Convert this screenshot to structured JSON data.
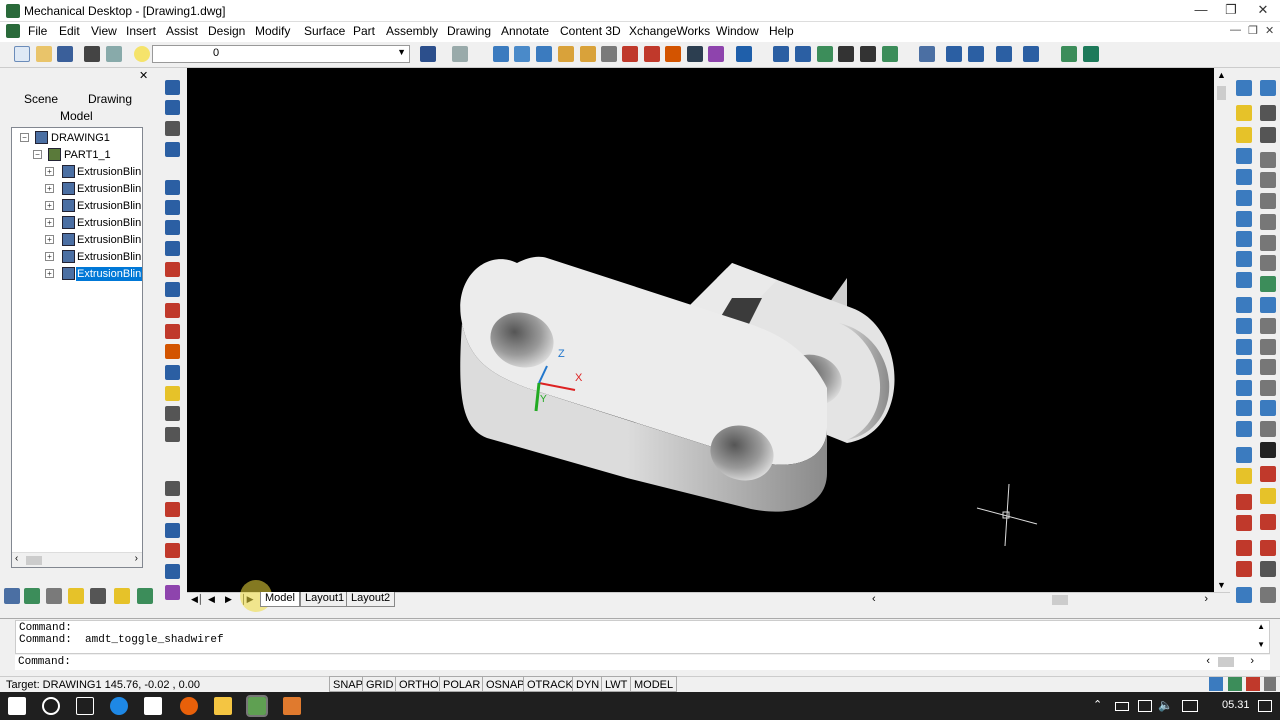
{
  "window": {
    "title": "Mechanical Desktop - [Drawing1.dwg]"
  },
  "menu": [
    "File",
    "Edit",
    "View",
    "Insert",
    "Assist",
    "Design",
    "Modify",
    "Surface",
    "Part",
    "Assembly",
    "Drawing",
    "Annotate",
    "Content 3D",
    "XchangeWorks",
    "Window",
    "Help"
  ],
  "toolbar": {
    "layer_value": "0"
  },
  "browser": {
    "tabs": {
      "scene": "Scene",
      "drawing": "Drawing",
      "model": "Model"
    },
    "tree": {
      "root": "DRAWING1",
      "part": "PART1_1",
      "features": [
        "ExtrusionBlin",
        "ExtrusionBlin",
        "ExtrusionBlin",
        "ExtrusionBlin",
        "ExtrusionBlin",
        "ExtrusionBlin",
        "ExtrusionBlin"
      ]
    }
  },
  "viewport": {
    "axis_x": "X",
    "axis_y": "Y",
    "axis_z": "Z"
  },
  "layout_tabs": [
    "Model",
    "Layout1",
    "Layout2"
  ],
  "command": {
    "history": [
      "Command:",
      "Command:  amdt_toggle_shadwiref"
    ],
    "prompt": "Command:"
  },
  "status": {
    "target": "Target: DRAWING1",
    "coordinates": "145.76, -0.02 , 0.00",
    "toggles": [
      "SNAP",
      "GRID",
      "ORTHO",
      "POLAR",
      "OSNAP",
      "OTRACK",
      "DYN",
      "LWT",
      "MODEL"
    ]
  },
  "taskbar": {
    "clock": "05.31"
  },
  "colors": {
    "viewport_bg": "#000000",
    "selection": "#0078d7",
    "taskbar": "#1f1f1f"
  }
}
